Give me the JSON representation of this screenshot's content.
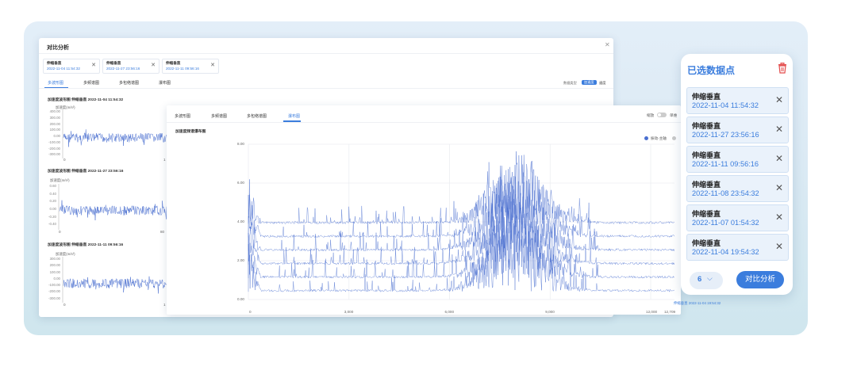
{
  "colors": {
    "accent": "#3b7ddd",
    "wave": "#4a6fd0",
    "backdrop": "#dbeaf4"
  },
  "analysis_window": {
    "title": "对比分析",
    "close_icon": "close-icon",
    "chips": [
      {
        "name": "伸缩垂直",
        "time": "2022-11-04 11:54:32"
      },
      {
        "name": "伸缩垂直",
        "time": "2022-11-27 23:56:16"
      },
      {
        "name": "伸缩垂直",
        "time": "2022-11-11 09:56:16"
      }
    ],
    "tabs": [
      "多波形图",
      "多频谱图",
      "多包络谱图",
      "瀑布图"
    ],
    "data_type_label": "数据类型",
    "data_type_options": [
      "加速度",
      "速度"
    ],
    "charts": [
      {
        "title": "加速度波形图  伸缩垂直 2022-11-04 11:54:32",
        "ylabel": "加速度(m/s²)",
        "ticks": [
          "400.00",
          "300.00",
          "200.00",
          "100.00",
          "0.00",
          "-100.00",
          "-200.00",
          "-300.00"
        ],
        "x0": "0",
        "x1": "1"
      },
      {
        "title": "加速度波形图  伸缩垂直 2022-11-27 23:56:16",
        "ylabel": "加速度(m/s²)",
        "ticks": [
          "0.60",
          "0.40",
          "0.20",
          "0.00",
          "-0.20",
          "-0.40"
        ],
        "x0": "0",
        "x1": "80"
      },
      {
        "title": "加速度波形图  伸缩垂直 2022-11-11 09:56:16",
        "ylabel": "加速度(m/s²)",
        "ticks": [
          "300.00",
          "200.00",
          "100.00",
          "0.00",
          "-100.00",
          "-200.00",
          "-300.00"
        ],
        "x0": "0",
        "x1": "1"
      }
    ]
  },
  "waterfall_window": {
    "tabs": [
      "多波形图",
      "多频谱图",
      "多包络谱图",
      "瀑布图"
    ],
    "active_tab": "瀑布图",
    "toggle_label": "缩放",
    "toggle_label2": "单维",
    "chart_title": "加速度频谱瀑布图",
    "legend": [
      "振动-主轴"
    ],
    "y_ticks": [
      "8.00",
      "6.00",
      "4.00",
      "2.00",
      "0.00"
    ],
    "x_ticks": [
      "0",
      "3,000",
      "6,000",
      "9,000",
      "12,000",
      "12,709"
    ],
    "series_tag": "伸缩垂直 2022-11-04 19:54:32"
  },
  "chart_data": {
    "type": "line",
    "title": "加速度频谱瀑布图",
    "xlabel": "",
    "ylabel": "",
    "xlim": [
      0,
      12709
    ],
    "ylim": [
      0,
      8
    ],
    "x_ticks": [
      0,
      3000,
      6000,
      9000,
      12000,
      12709
    ],
    "y_ticks": [
      0,
      2,
      4,
      6,
      8
    ],
    "series": [
      {
        "name": "振动-主轴",
        "values": []
      }
    ],
    "grid": true,
    "legend_placement": "top-right"
  },
  "selection_panel": {
    "title": "已选数据点",
    "trash_icon": "trash-icon",
    "items": [
      {
        "name": "伸缩垂直",
        "time": "2022-11-04 11:54:32"
      },
      {
        "name": "伸缩垂直",
        "time": "2022-11-27 23:56:16"
      },
      {
        "name": "伸缩垂直",
        "time": "2022-11-11 09:56:16"
      },
      {
        "name": "伸缩垂直",
        "time": "2022-11-08 23:54:32"
      },
      {
        "name": "伸缩垂直",
        "time": "2022-11-07 01:54:32"
      },
      {
        "name": "伸缩垂直",
        "time": "2022-11-04 19:54:32"
      }
    ],
    "count": "6",
    "compare_button": "对比分析"
  }
}
